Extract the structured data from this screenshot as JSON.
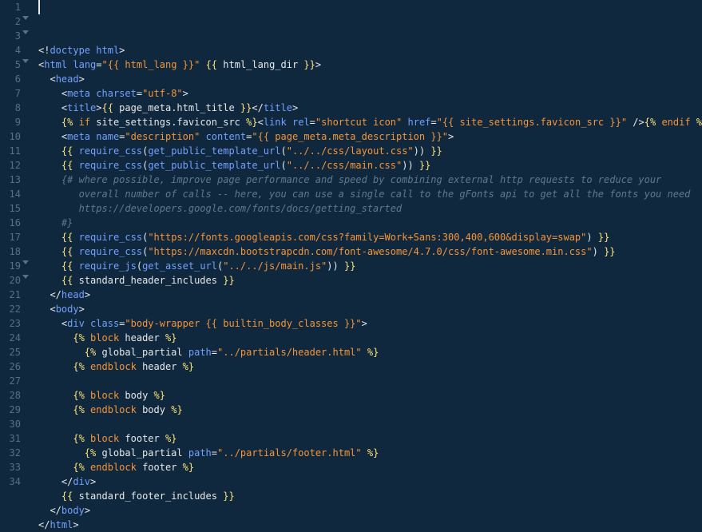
{
  "lineCount": 34,
  "foldLines": [
    2,
    3,
    5,
    19,
    20
  ],
  "cursorLine": 1,
  "tokens": [
    [
      [
        "pun",
        "<!"
      ],
      [
        "tag",
        "doctype"
      ],
      [
        "pun",
        " "
      ],
      [
        "attr",
        "html"
      ],
      [
        "pun",
        ">"
      ]
    ],
    [
      [
        "pun",
        "<"
      ],
      [
        "tag",
        "html"
      ],
      [
        "pun",
        " "
      ],
      [
        "attr",
        "lang"
      ],
      [
        "pun",
        "="
      ],
      [
        "str",
        "\"{{ html_lang }}\""
      ],
      [
        "pun",
        " "
      ],
      [
        "js",
        "{{"
      ],
      [
        "pun",
        " "
      ],
      [
        "var",
        "html_lang_dir"
      ],
      [
        "pun",
        " "
      ],
      [
        "js",
        "}}"
      ],
      [
        "pun",
        ">"
      ]
    ],
    [
      [
        "pun",
        "  <"
      ],
      [
        "tag",
        "head"
      ],
      [
        "pun",
        ">"
      ]
    ],
    [
      [
        "pun",
        "    <"
      ],
      [
        "tag",
        "meta"
      ],
      [
        "pun",
        " "
      ],
      [
        "attr",
        "charset"
      ],
      [
        "pun",
        "="
      ],
      [
        "str",
        "\"utf-8\""
      ],
      [
        "pun",
        ">"
      ]
    ],
    [
      [
        "pun",
        "    <"
      ],
      [
        "tag",
        "title"
      ],
      [
        "pun",
        ">"
      ],
      [
        "js",
        "{{"
      ],
      [
        "pun",
        " "
      ],
      [
        "var",
        "page_meta.html_title"
      ],
      [
        "pun",
        " "
      ],
      [
        "js",
        "}}"
      ],
      [
        "pun",
        "</"
      ],
      [
        "tag",
        "title"
      ],
      [
        "pun",
        ">"
      ]
    ],
    [
      [
        "pun",
        "    "
      ],
      [
        "js",
        "{%"
      ],
      [
        "pun",
        " "
      ],
      [
        "kw",
        "if"
      ],
      [
        "pun",
        " "
      ],
      [
        "var",
        "site_settings.favicon_src"
      ],
      [
        "pun",
        " "
      ],
      [
        "js",
        "%}"
      ],
      [
        "pun",
        "<"
      ],
      [
        "tag",
        "link"
      ],
      [
        "pun",
        " "
      ],
      [
        "attr",
        "rel"
      ],
      [
        "pun",
        "="
      ],
      [
        "str",
        "\"shortcut icon\""
      ],
      [
        "pun",
        " "
      ],
      [
        "attr",
        "href"
      ],
      [
        "pun",
        "="
      ],
      [
        "str",
        "\"{{ site_settings.favicon_src }}\""
      ],
      [
        "pun",
        " />"
      ],
      [
        "js",
        "{%"
      ],
      [
        "pun",
        " "
      ],
      [
        "kw",
        "endif"
      ],
      [
        "pun",
        " "
      ],
      [
        "js",
        "%}"
      ]
    ],
    [
      [
        "pun",
        "    <"
      ],
      [
        "tag",
        "meta"
      ],
      [
        "pun",
        " "
      ],
      [
        "attr",
        "name"
      ],
      [
        "pun",
        "="
      ],
      [
        "str",
        "\"description\""
      ],
      [
        "pun",
        " "
      ],
      [
        "attr",
        "content"
      ],
      [
        "pun",
        "="
      ],
      [
        "str",
        "\"{{ page_meta.meta_description }}\""
      ],
      [
        "pun",
        ">"
      ]
    ],
    [
      [
        "pun",
        "    "
      ],
      [
        "js",
        "{{"
      ],
      [
        "pun",
        " "
      ],
      [
        "tag",
        "require_css"
      ],
      [
        "pun",
        "("
      ],
      [
        "tag",
        "get_public_template_url"
      ],
      [
        "pun",
        "("
      ],
      [
        "str",
        "\"../../css/layout.css\""
      ],
      [
        "pun",
        "))"
      ],
      [
        "pun",
        " "
      ],
      [
        "js",
        "}}"
      ]
    ],
    [
      [
        "pun",
        "    "
      ],
      [
        "js",
        "{{"
      ],
      [
        "pun",
        " "
      ],
      [
        "tag",
        "require_css"
      ],
      [
        "pun",
        "("
      ],
      [
        "tag",
        "get_public_template_url"
      ],
      [
        "pun",
        "("
      ],
      [
        "str",
        "\"../../css/main.css\""
      ],
      [
        "pun",
        "))"
      ],
      [
        "pun",
        " "
      ],
      [
        "js",
        "}}"
      ]
    ],
    [
      [
        "pun",
        "    "
      ],
      [
        "cmt",
        "{# where possible, improve page performance and speed by combining external http requests to reduce your"
      ]
    ],
    [
      [
        "pun",
        "       "
      ],
      [
        "cmt",
        "overall number of calls -- here, you can use a single call to the gFonts api to get all the fonts you need"
      ]
    ],
    [
      [
        "pun",
        "       "
      ],
      [
        "cmt",
        "https://developers.google.com/fonts/docs/getting_started"
      ]
    ],
    [
      [
        "pun",
        "    "
      ],
      [
        "cmt",
        "#}"
      ]
    ],
    [
      [
        "pun",
        "    "
      ],
      [
        "js",
        "{{"
      ],
      [
        "pun",
        " "
      ],
      [
        "tag",
        "require_css"
      ],
      [
        "pun",
        "("
      ],
      [
        "str",
        "\"https://fonts.googleapis.com/css?family=Work+Sans:300,400,600&display=swap\""
      ],
      [
        "pun",
        ")"
      ],
      [
        "pun",
        " "
      ],
      [
        "js",
        "}}"
      ]
    ],
    [
      [
        "pun",
        "    "
      ],
      [
        "js",
        "{{"
      ],
      [
        "pun",
        " "
      ],
      [
        "tag",
        "require_css"
      ],
      [
        "pun",
        "("
      ],
      [
        "str",
        "\"https://maxcdn.bootstrapcdn.com/font-awesome/4.7.0/css/font-awesome.min.css\""
      ],
      [
        "pun",
        ")"
      ],
      [
        "pun",
        " "
      ],
      [
        "js",
        "}}"
      ]
    ],
    [
      [
        "pun",
        "    "
      ],
      [
        "js",
        "{{"
      ],
      [
        "pun",
        " "
      ],
      [
        "tag",
        "require_js"
      ],
      [
        "pun",
        "("
      ],
      [
        "tag",
        "get_asset_url"
      ],
      [
        "pun",
        "("
      ],
      [
        "str",
        "\"../../js/main.js\""
      ],
      [
        "pun",
        "))"
      ],
      [
        "pun",
        " "
      ],
      [
        "js",
        "}}"
      ]
    ],
    [
      [
        "pun",
        "    "
      ],
      [
        "js",
        "{{"
      ],
      [
        "pun",
        " "
      ],
      [
        "var",
        "standard_header_includes"
      ],
      [
        "pun",
        " "
      ],
      [
        "js",
        "}}"
      ]
    ],
    [
      [
        "pun",
        "  </"
      ],
      [
        "tag",
        "head"
      ],
      [
        "pun",
        ">"
      ]
    ],
    [
      [
        "pun",
        "  <"
      ],
      [
        "tag",
        "body"
      ],
      [
        "pun",
        ">"
      ]
    ],
    [
      [
        "pun",
        "    <"
      ],
      [
        "tag",
        "div"
      ],
      [
        "pun",
        " "
      ],
      [
        "attr",
        "class"
      ],
      [
        "pun",
        "="
      ],
      [
        "str",
        "\"body-wrapper {{ builtin_body_classes }}\""
      ],
      [
        "pun",
        ">"
      ]
    ],
    [
      [
        "pun",
        "      "
      ],
      [
        "js",
        "{%"
      ],
      [
        "pun",
        " "
      ],
      [
        "kw",
        "block"
      ],
      [
        "pun",
        " "
      ],
      [
        "var",
        "header"
      ],
      [
        "pun",
        " "
      ],
      [
        "js",
        "%}"
      ]
    ],
    [
      [
        "pun",
        "        "
      ],
      [
        "js",
        "{%"
      ],
      [
        "pun",
        " "
      ],
      [
        "var",
        "global_partial"
      ],
      [
        "pun",
        " "
      ],
      [
        "attr",
        "path"
      ],
      [
        "pun",
        "="
      ],
      [
        "str",
        "\"../partials/header.html\""
      ],
      [
        "pun",
        " "
      ],
      [
        "js",
        "%}"
      ]
    ],
    [
      [
        "pun",
        "      "
      ],
      [
        "js",
        "{%"
      ],
      [
        "pun",
        " "
      ],
      [
        "kw",
        "endblock"
      ],
      [
        "pun",
        " "
      ],
      [
        "var",
        "header"
      ],
      [
        "pun",
        " "
      ],
      [
        "js",
        "%}"
      ]
    ],
    [],
    [
      [
        "pun",
        "      "
      ],
      [
        "js",
        "{%"
      ],
      [
        "pun",
        " "
      ],
      [
        "kw",
        "block"
      ],
      [
        "pun",
        " "
      ],
      [
        "var",
        "body"
      ],
      [
        "pun",
        " "
      ],
      [
        "js",
        "%}"
      ]
    ],
    [
      [
        "pun",
        "      "
      ],
      [
        "js",
        "{%"
      ],
      [
        "pun",
        " "
      ],
      [
        "kw",
        "endblock"
      ],
      [
        "pun",
        " "
      ],
      [
        "var",
        "body"
      ],
      [
        "pun",
        " "
      ],
      [
        "js",
        "%}"
      ]
    ],
    [],
    [
      [
        "pun",
        "      "
      ],
      [
        "js",
        "{%"
      ],
      [
        "pun",
        " "
      ],
      [
        "kw",
        "block"
      ],
      [
        "pun",
        " "
      ],
      [
        "var",
        "footer"
      ],
      [
        "pun",
        " "
      ],
      [
        "js",
        "%}"
      ]
    ],
    [
      [
        "pun",
        "        "
      ],
      [
        "js",
        "{%"
      ],
      [
        "pun",
        " "
      ],
      [
        "var",
        "global_partial"
      ],
      [
        "pun",
        " "
      ],
      [
        "attr",
        "path"
      ],
      [
        "pun",
        "="
      ],
      [
        "str",
        "\"../partials/footer.html\""
      ],
      [
        "pun",
        " "
      ],
      [
        "js",
        "%}"
      ]
    ],
    [
      [
        "pun",
        "      "
      ],
      [
        "js",
        "{%"
      ],
      [
        "pun",
        " "
      ],
      [
        "kw",
        "endblock"
      ],
      [
        "pun",
        " "
      ],
      [
        "var",
        "footer"
      ],
      [
        "pun",
        " "
      ],
      [
        "js",
        "%}"
      ]
    ],
    [
      [
        "pun",
        "    </"
      ],
      [
        "tag",
        "div"
      ],
      [
        "pun",
        ">"
      ]
    ],
    [
      [
        "pun",
        "    "
      ],
      [
        "js",
        "{{"
      ],
      [
        "pun",
        " "
      ],
      [
        "var",
        "standard_footer_includes"
      ],
      [
        "pun",
        " "
      ],
      [
        "js",
        "}}"
      ]
    ],
    [
      [
        "pun",
        "  </"
      ],
      [
        "tag",
        "body"
      ],
      [
        "pun",
        ">"
      ]
    ],
    [
      [
        "pun",
        "</"
      ],
      [
        "tag",
        "html"
      ],
      [
        "pun",
        ">"
      ]
    ]
  ]
}
